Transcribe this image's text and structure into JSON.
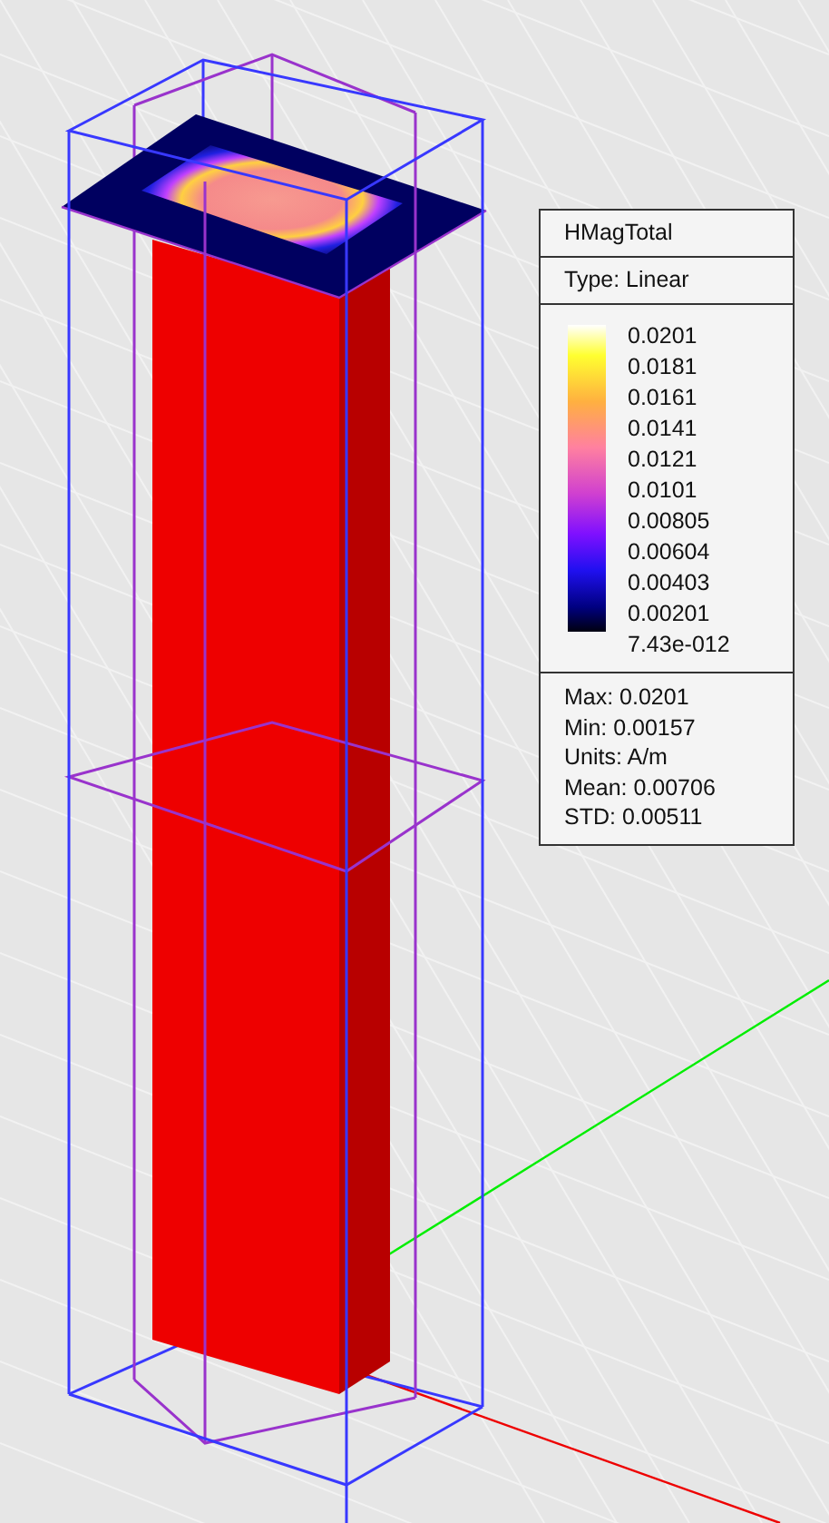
{
  "legend": {
    "title": "HMagTotal",
    "type": "Type: Linear",
    "scale_labels": [
      "0.0201",
      "0.0181",
      "0.0161",
      "0.0141",
      "0.0121",
      "0.0101",
      "0.00805",
      "0.00604",
      "0.00403",
      "0.00201",
      "7.43e-012"
    ],
    "stats": [
      "Max: 0.0201",
      "Min: 0.00157",
      "Units: A/m",
      "Mean: 0.00706",
      "STD: 0.00511"
    ]
  }
}
